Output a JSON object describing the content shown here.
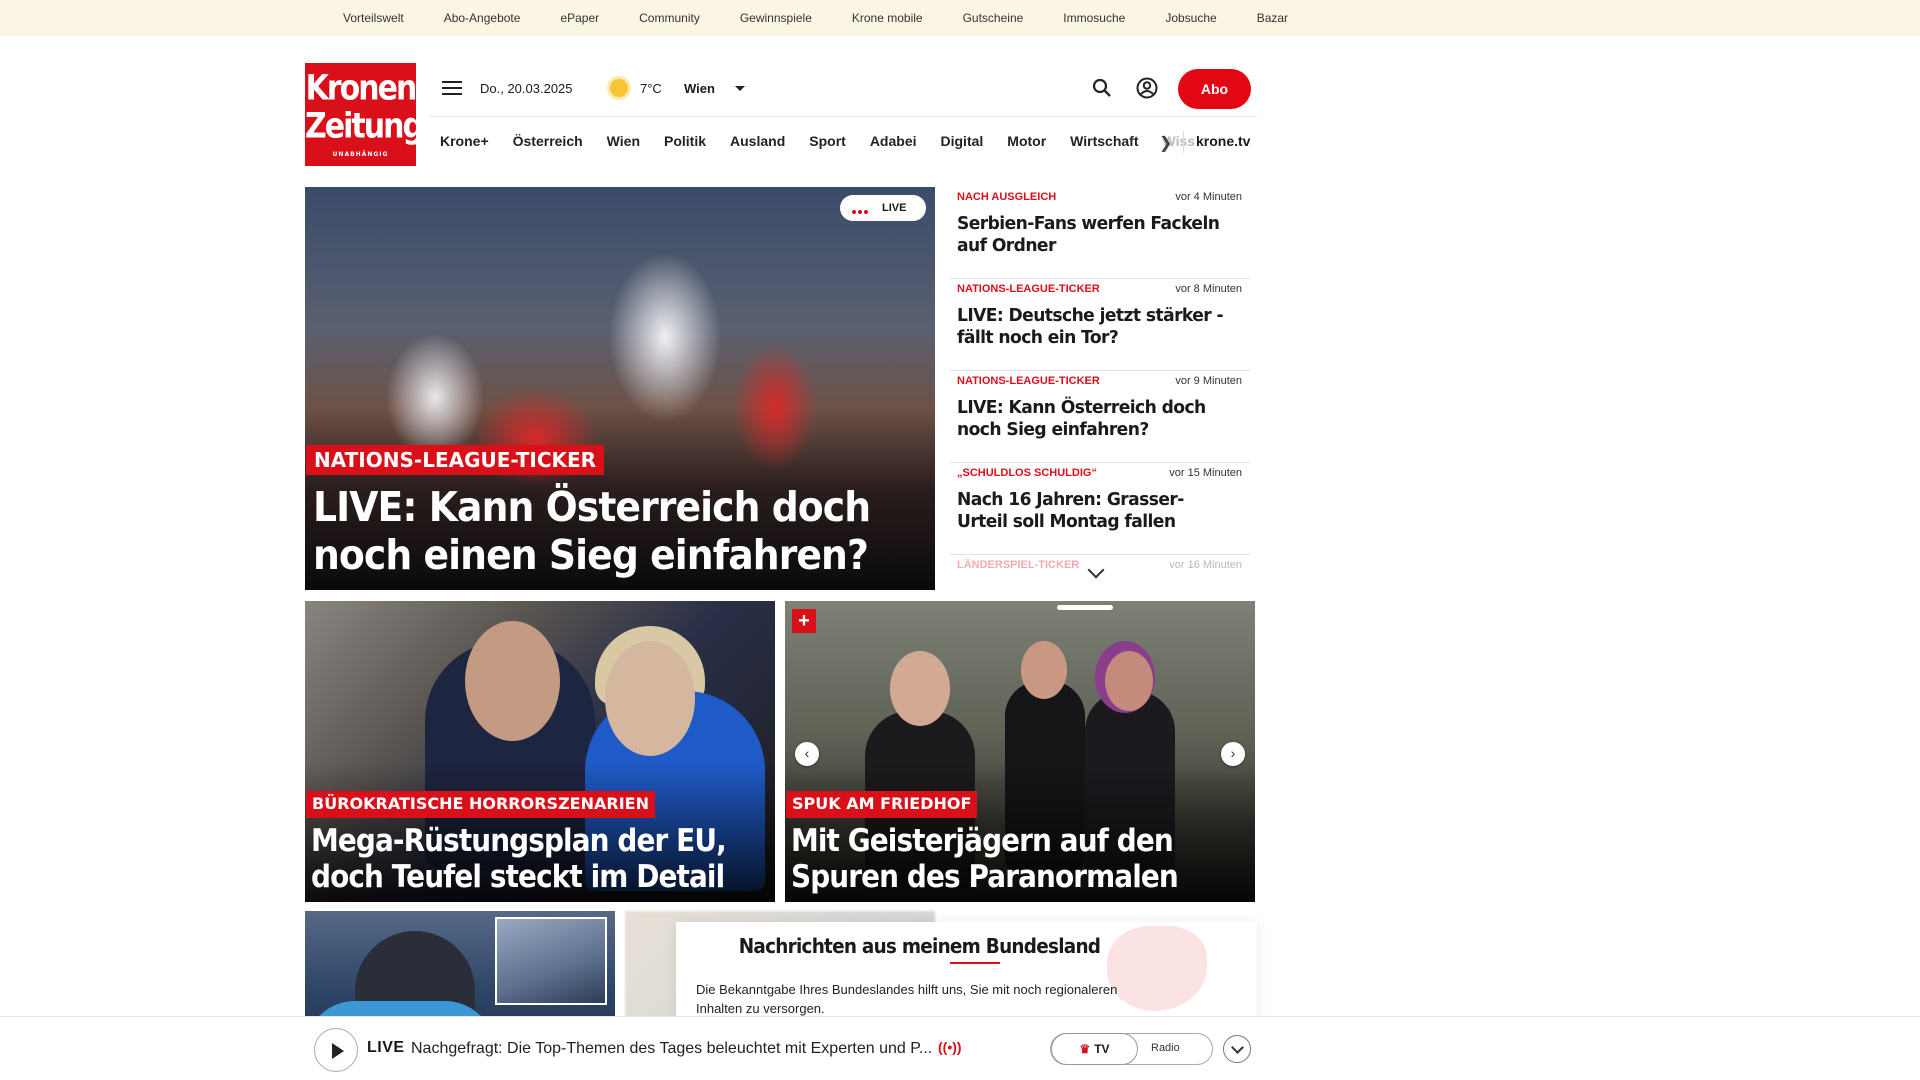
{
  "top_links": [
    "Vorteilswelt",
    "Abo-Angebote",
    "ePaper",
    "Community",
    "Gewinnspiele",
    "Krone mobile",
    "Gutscheine",
    "Immosuche",
    "Jobsuche",
    "Bazar"
  ],
  "logo": {
    "line1": "Kronen",
    "line2": "Zeitung",
    "tagline": "UNABHÄNGIG"
  },
  "header": {
    "date": "Do., 20.03.2025",
    "temperature": "7°C",
    "city": "Wien",
    "abo_label": "Abo"
  },
  "nav": {
    "items": [
      "Krone+",
      "Österreich",
      "Wien",
      "Politik",
      "Ausland",
      "Sport",
      "Adabei",
      "Digital",
      "Motor",
      "Wirtschaft"
    ],
    "faded_item": "Wiss",
    "tv_link": "krone.tv"
  },
  "hero": {
    "live_badge": "LIVE",
    "kicker": "NATIONS-LEAGUE-TICKER",
    "headline": "LIVE: Kann Österreich doch noch einen Sieg einfahren?"
  },
  "ticker": [
    {
      "kicker": "NACH AUSGLEICH",
      "time": "vor 4 Minuten",
      "title": "Serbien-Fans werfen Fackeln auf Ordner"
    },
    {
      "kicker": "NATIONS-LEAGUE-TICKER",
      "time": "vor 8 Minuten",
      "title": "LIVE: Deutsche jetzt stärker - fällt noch ein Tor?"
    },
    {
      "kicker": "NATIONS-LEAGUE-TICKER",
      "time": "vor 9 Minuten",
      "title": "LIVE: Kann Österreich doch noch Sieg einfahren?"
    },
    {
      "kicker": "„SCHULDLOS SCHULDIG“",
      "time": "vor 15 Minuten",
      "title": "Nach 16 Jahren: Grasser-Urteil soll Montag fallen"
    },
    {
      "kicker": "LÄNDERSPIEL-TICKER",
      "time": "vor 16 Minuten",
      "title": ""
    }
  ],
  "card_left": {
    "kicker": "BÜROKRATISCHE HORRORSZENARIEN",
    "headline": "Mega-Rüstungsplan der EU, doch Teufel steckt im Detail"
  },
  "card_right": {
    "plus": "+",
    "kicker": "SPUK AM FRIEDHOF",
    "headline": "Mit Geisterjägern auf den Spuren des Paranormalen"
  },
  "popup": {
    "title": "Nachrichten aus meinem Bundesland",
    "text": "Die Bekanntgabe Ihres Bundeslandes hilft uns, Sie mit noch regionaleren Inhalten zu versorgen."
  },
  "player": {
    "live_label": "LIVE",
    "title": "Nachgefragt: Die Top-Themen des Tages beleuchtet mit Experten und P...",
    "tv_label": "TV",
    "radio_label": "Radio"
  },
  "colors": {
    "brand_red": "#d90f1a",
    "topbar_bg": "#fbf6e4"
  }
}
